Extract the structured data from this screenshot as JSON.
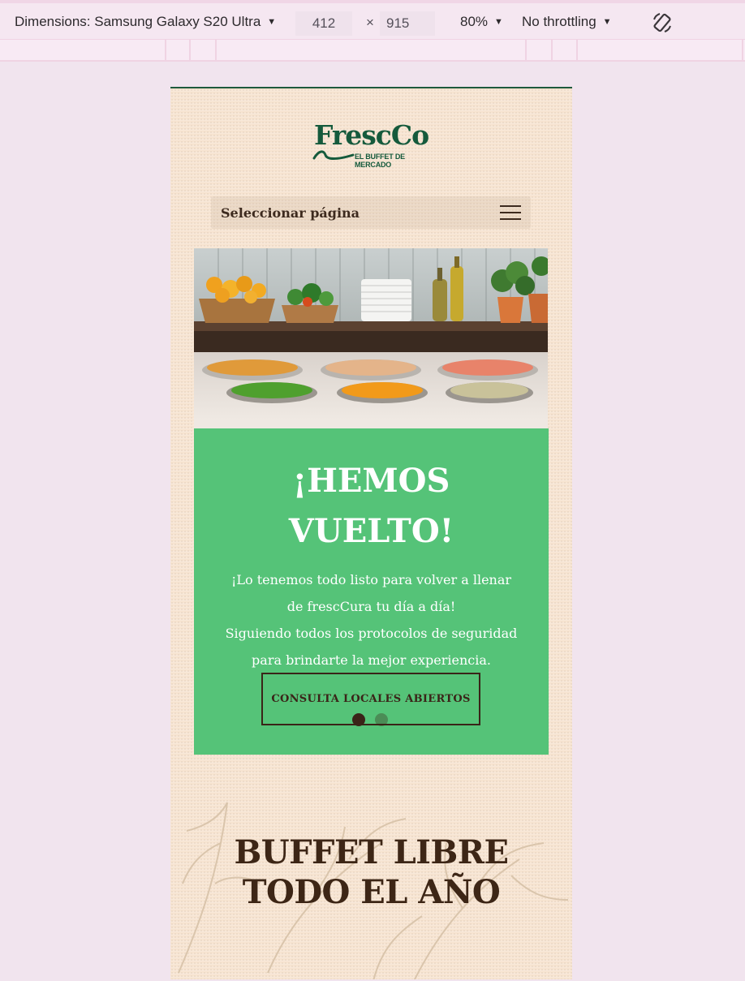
{
  "devtools": {
    "dimensions_label": "Dimensions: Samsung Galaxy S20 Ultra",
    "width": "412",
    "times": "×",
    "height": "915",
    "zoom": "80%",
    "throttling": "No throttling"
  },
  "site": {
    "logo_word": "FrescCo",
    "logo_tag": "EL BUFFET DE MERCADO",
    "nav_select_label": "Seleccionar página",
    "hero": {
      "title_line1": "¡HEMOS",
      "title_line2": "VUELTO!",
      "text_line1": "¡Lo tenemos todo listo para volver a llenar",
      "text_line2": "de frescCura tu día a día!",
      "text_line3": "Siguiendo todos los protocolos de seguridad",
      "text_line4": "para brindarte la mejor experiencia.",
      "button_label": "CONSULTA LOCALES ABIERTOS",
      "slide_count": 2,
      "active_slide": 1
    },
    "section_title_line1": "BUFFET LIBRE",
    "section_title_line2": "TODO EL AÑO"
  },
  "colors": {
    "brand_green": "#155a3c",
    "hero_green": "#55c378",
    "text_brown": "#3d2616",
    "page_bg": "#f7e4d1"
  },
  "icons": [
    "caret-down-icon",
    "rotate-icon",
    "hamburger-menu-icon"
  ]
}
